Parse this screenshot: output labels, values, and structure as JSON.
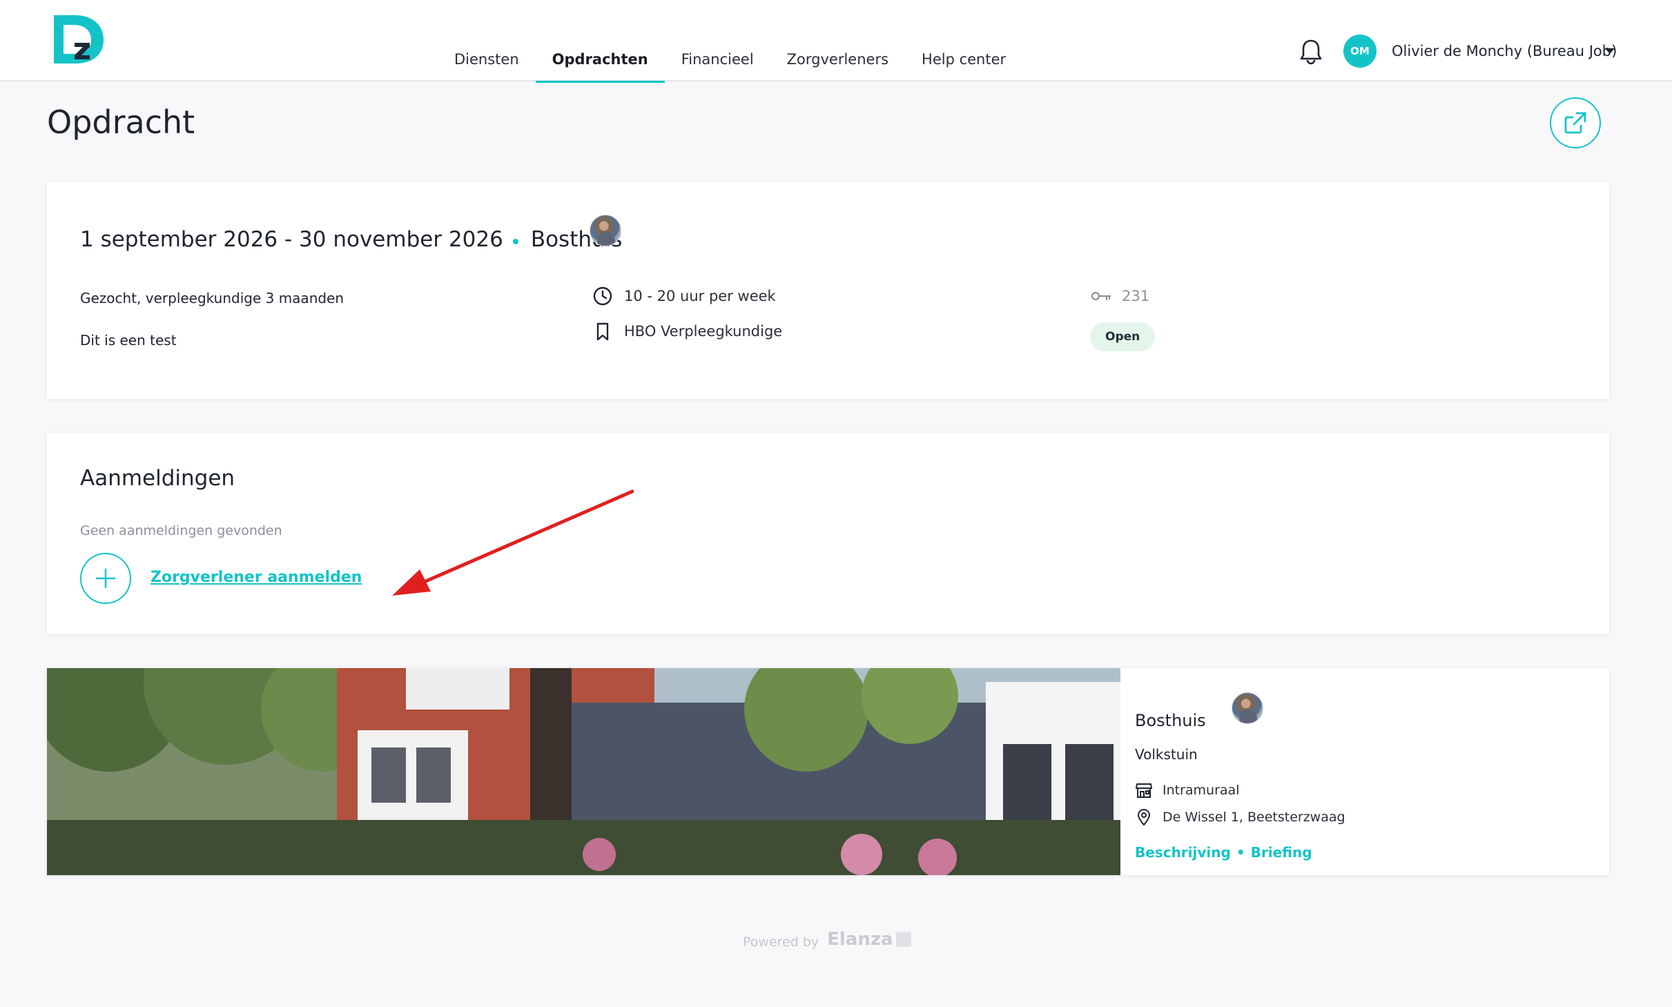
{
  "header": {
    "nav": [
      {
        "label": "Diensten",
        "active": false
      },
      {
        "label": "Opdrachten",
        "active": true
      },
      {
        "label": "Financieel",
        "active": false
      },
      {
        "label": "Zorgverleners",
        "active": false
      },
      {
        "label": "Help center",
        "active": false
      }
    ],
    "user_initials": "OM",
    "user_name": "Olivier de Monchy (Bureau Job)",
    "icons": {
      "bell": "bell-icon",
      "caret": "caret-down-icon"
    }
  },
  "page": {
    "title": "Opdracht"
  },
  "assignment": {
    "date_range": "1 september 2026 - 30 november 2026",
    "location": "Bosthuis",
    "subtitle": "Gezocht, verpleegkundige 3 maanden",
    "description": "Dit is een test",
    "hours": "10 - 20 uur per week",
    "level": "HBO Verpleegkundige",
    "id": "231",
    "status": "Open"
  },
  "signups": {
    "title": "Aanmeldingen",
    "empty_text": "Geen aanmeldingen gevonden",
    "add_label": "Zorgverlener aanmelden"
  },
  "location_card": {
    "name": "Bosthuis",
    "department": "Volkstuin",
    "type": "Intramuraal",
    "address": "De Wissel 1, Beetsterzwaag",
    "link_description": "Beschrijving",
    "link_separator": "•",
    "link_briefing": "Briefing"
  },
  "footer": {
    "powered_by": "Powered by",
    "brand": "Elanza"
  },
  "colors": {
    "accent": "#14c3c8",
    "status_open_bg": "#e4f5ec",
    "annotation_arrow": "#e02020"
  }
}
